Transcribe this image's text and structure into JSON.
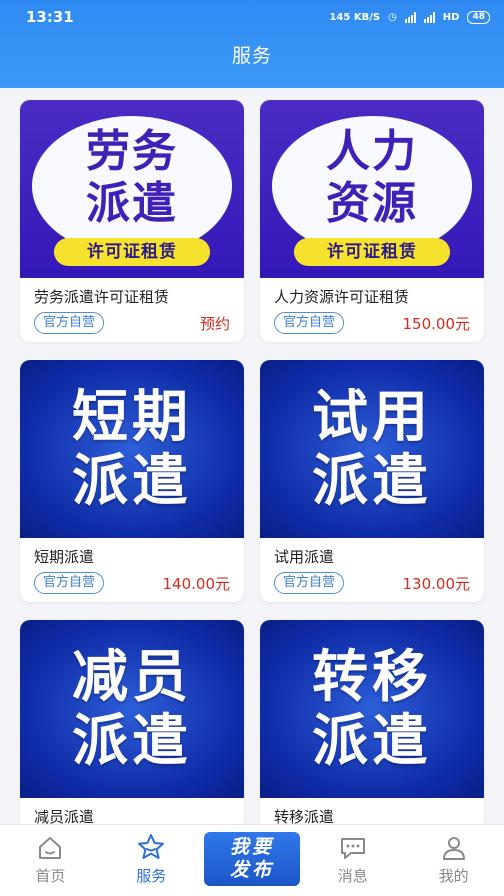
{
  "status": {
    "time": "13:31",
    "speed": "145 KB/S",
    "net": "HD",
    "battery": "48"
  },
  "header": {
    "title": "服务"
  },
  "cards": [
    {
      "img_line1": "劳务",
      "img_line2": "派遣",
      "img_tag": "许可证租赁",
      "name": "劳务派遣许可证租赁",
      "badge": "官方自营",
      "price": "预约"
    },
    {
      "img_line1": "人力",
      "img_line2": "资源",
      "img_tag": "许可证租赁",
      "name": "人力资源许可证租赁",
      "badge": "官方自营",
      "price": "150.00元"
    },
    {
      "img_line1": "短期",
      "img_line2": "派遣",
      "name": "短期派遣",
      "badge": "官方自营",
      "price": "140.00元"
    },
    {
      "img_line1": "试用",
      "img_line2": "派遣",
      "name": "试用派遣",
      "badge": "官方自营",
      "price": "130.00元"
    },
    {
      "img_line1": "减员",
      "img_line2": "派遣",
      "name": "减员派遣",
      "badge": "",
      "price": ""
    },
    {
      "img_line1": "转移",
      "img_line2": "派遣",
      "name": "转移派遣",
      "badge": "",
      "price": ""
    }
  ],
  "tabbar": {
    "home": "首页",
    "service": "服务",
    "publish_line1": "我要",
    "publish_line2": "发布",
    "messages": "消息",
    "mine": "我的"
  },
  "colors": {
    "accent": "#2d6fd8",
    "price": "#d42b1f",
    "header": "#3d99f6"
  }
}
